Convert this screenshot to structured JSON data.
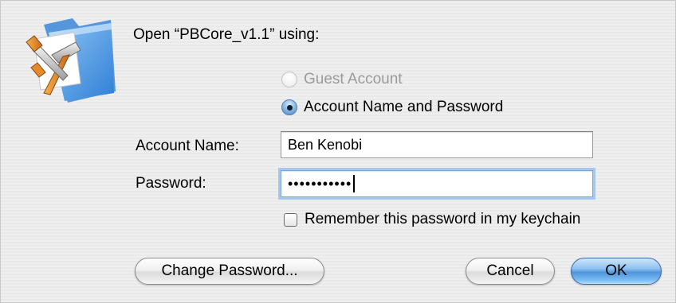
{
  "dialog": {
    "title": "Open “PBCore_v1.1” using:",
    "icon": "developer-tools-folder-icon"
  },
  "auth": {
    "guest_label": "Guest Account",
    "guest_enabled": false,
    "account_label": "Account Name and Password",
    "account_selected": true
  },
  "fields": {
    "account_name_label": "Account Name:",
    "account_name_value": "Ben Kenobi",
    "password_label": "Password:",
    "password_mask": "•••••••••••"
  },
  "keychain": {
    "label": "Remember this password in my keychain",
    "checked": false
  },
  "buttons": {
    "change_password": "Change Password...",
    "cancel": "Cancel",
    "ok": "OK"
  },
  "colors": {
    "accent": "#4f95dc",
    "disabled_text": "#9b9b9b",
    "focus_ring": "#a7c8ee"
  }
}
